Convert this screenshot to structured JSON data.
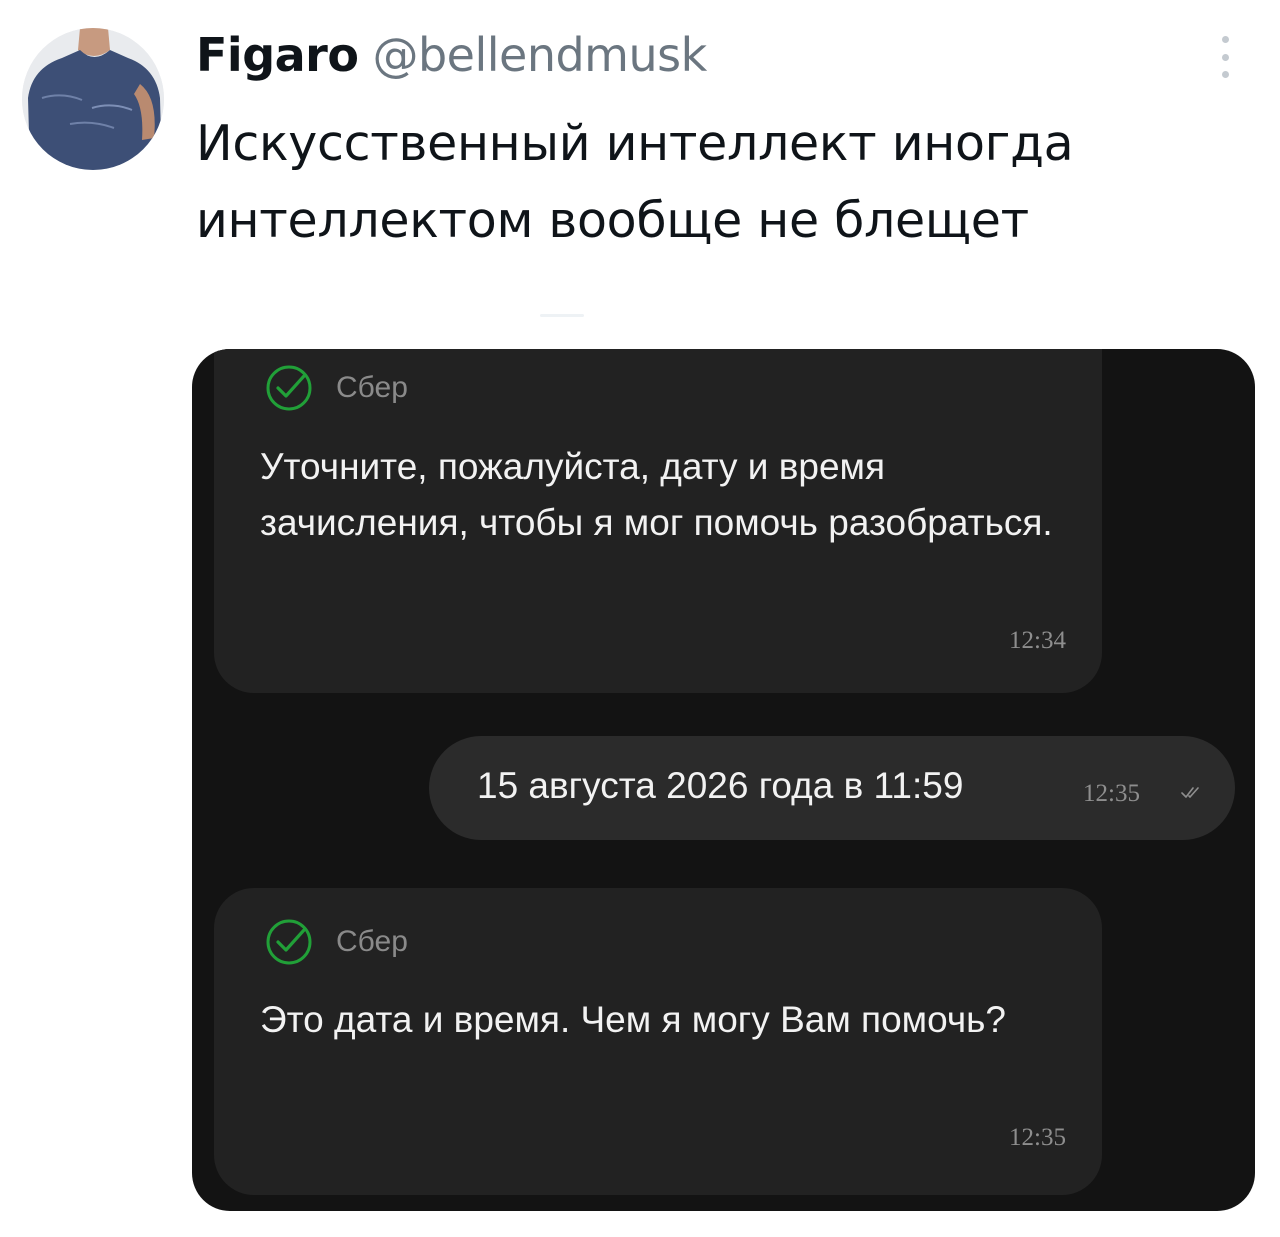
{
  "tweet": {
    "author_name": "Figaro",
    "author_handle": "@bellendmusk",
    "text": "Искусственный интеллект иногда интеллектом вообще не блещет",
    "avatar_icon": "avatar-photo",
    "menu_icon": "more-vertical-icon"
  },
  "chat": {
    "background_color": "#131313",
    "bubble_color": "#222222",
    "accent_color": "#21a038",
    "messages": [
      {
        "role": "bot",
        "sender": "Сбер",
        "sender_icon": "sber-check-icon",
        "text": "Уточните, пожалуйста, дату и время зачисления, чтобы я мог помочь разобраться.",
        "time": "12:34"
      },
      {
        "role": "user",
        "text": "15 августа 2026 года в 11:59",
        "time": "12:35",
        "status_icon": "double-check-icon"
      },
      {
        "role": "bot",
        "sender": "Сбер",
        "sender_icon": "sber-check-icon",
        "text": "Это дата и время. Чем я могу Вам помочь?",
        "time": "12:35"
      }
    ]
  }
}
